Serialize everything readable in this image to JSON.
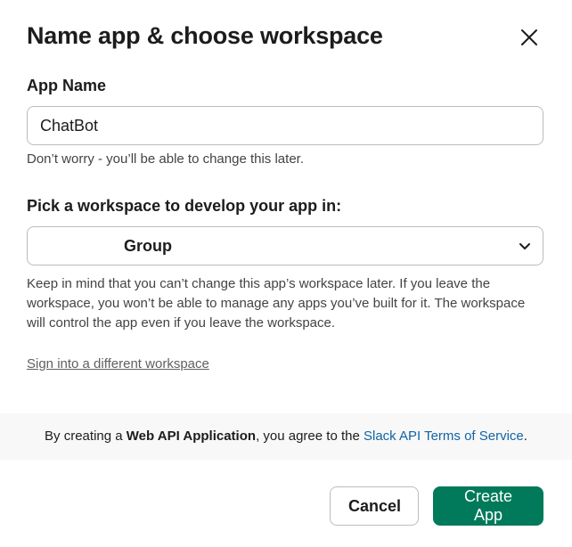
{
  "dialog": {
    "title": "Name app & choose workspace"
  },
  "app_name": {
    "label": "App Name",
    "value": "ChatBot",
    "hint": "Don’t worry - you’ll be able to change this later."
  },
  "workspace": {
    "label": "Pick a workspace to develop your app in:",
    "selected": "Group",
    "hint": "Keep in mind that you can’t change this app’s workspace later. If you leave the workspace, you won’t be able to manage any apps you’ve built for it. The workspace will control the app even if you leave the workspace.",
    "sign_in_link": "Sign into a different workspace"
  },
  "terms": {
    "prefix": "By creating a ",
    "app_type": "Web API Application",
    "middle": ", you agree to the ",
    "link": "Slack API Terms of Service",
    "suffix": "."
  },
  "footer": {
    "cancel_label": "Cancel",
    "create_label": "Create App"
  },
  "colors": {
    "primary": "#007a5a",
    "link": "#1264a3",
    "text": "#1d1c1d"
  },
  "icons": {
    "close": "close-icon",
    "chevron": "chevron-down-icon"
  }
}
